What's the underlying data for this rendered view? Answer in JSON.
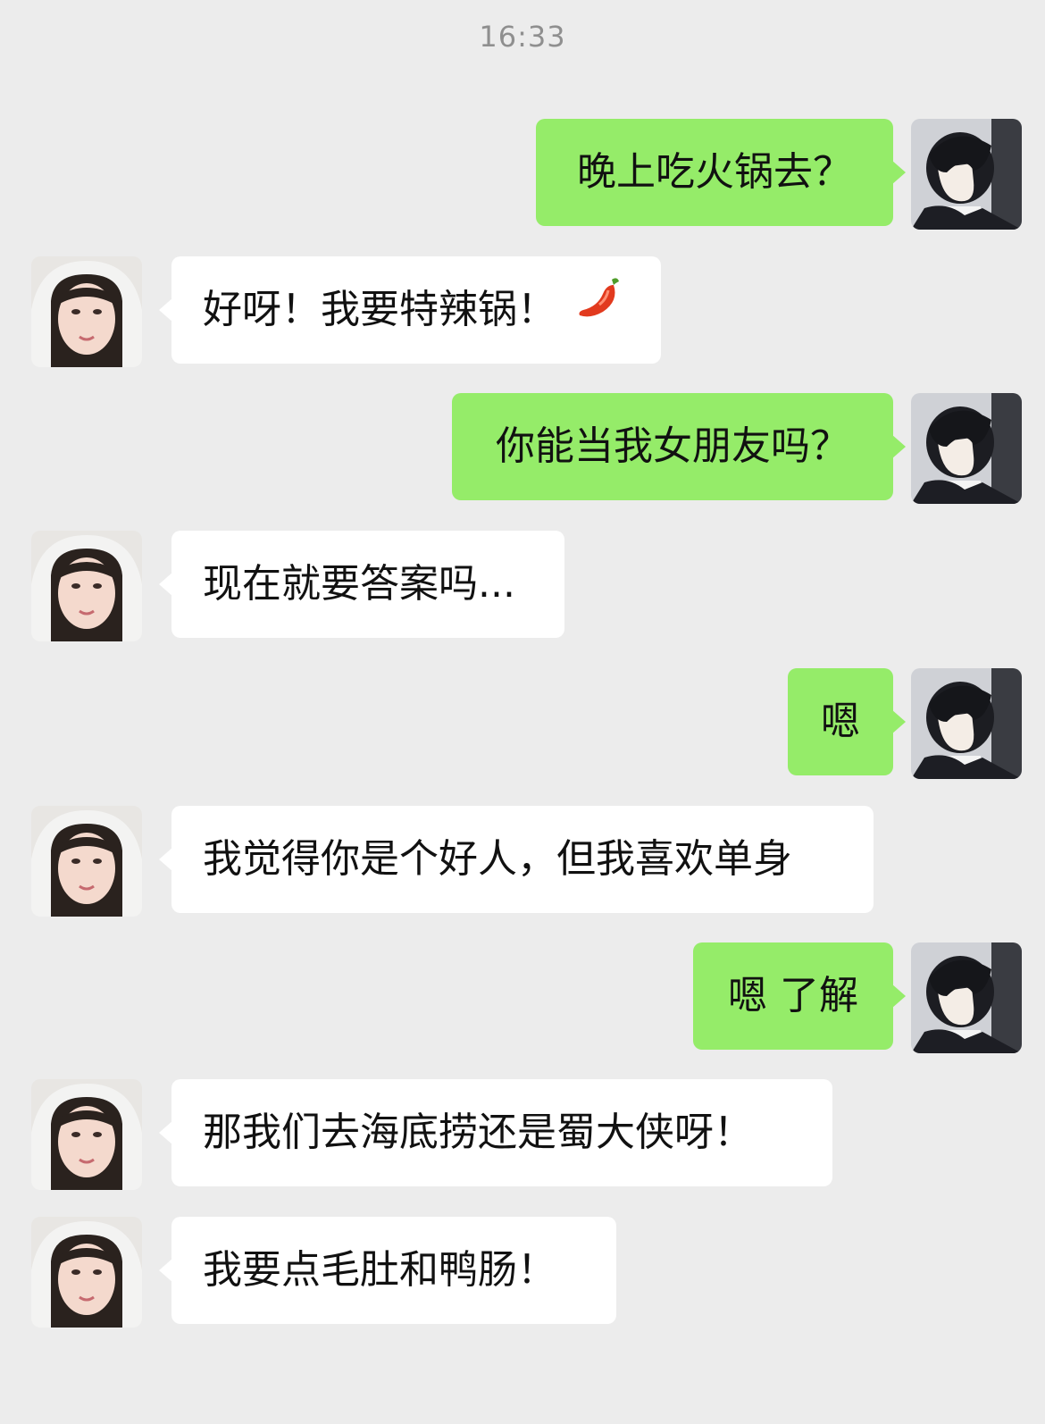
{
  "chat": {
    "timestamp": "16:33",
    "messages": [
      {
        "sender": "self",
        "text": "晚上吃火锅去？"
      },
      {
        "sender": "other",
        "text": "好呀！我要特辣锅！",
        "emoji": "chili-pepper-icon"
      },
      {
        "sender": "self",
        "text": "你能当我女朋友吗？"
      },
      {
        "sender": "other",
        "text": "现在就要答案吗..."
      },
      {
        "sender": "self",
        "text": "嗯"
      },
      {
        "sender": "other",
        "text": "我觉得你是个好人，但我喜欢单身"
      },
      {
        "sender": "self",
        "text": "嗯 了解"
      },
      {
        "sender": "other",
        "text": "那我们去海底捞还是蜀大侠呀！"
      },
      {
        "sender": "other",
        "text": "我要点毛肚和鸭肠！"
      }
    ]
  },
  "colors": {
    "background": "#ececec",
    "self_bubble": "#95ec69",
    "other_bubble": "#ffffff",
    "timestamp_text": "#8f8f8f"
  }
}
